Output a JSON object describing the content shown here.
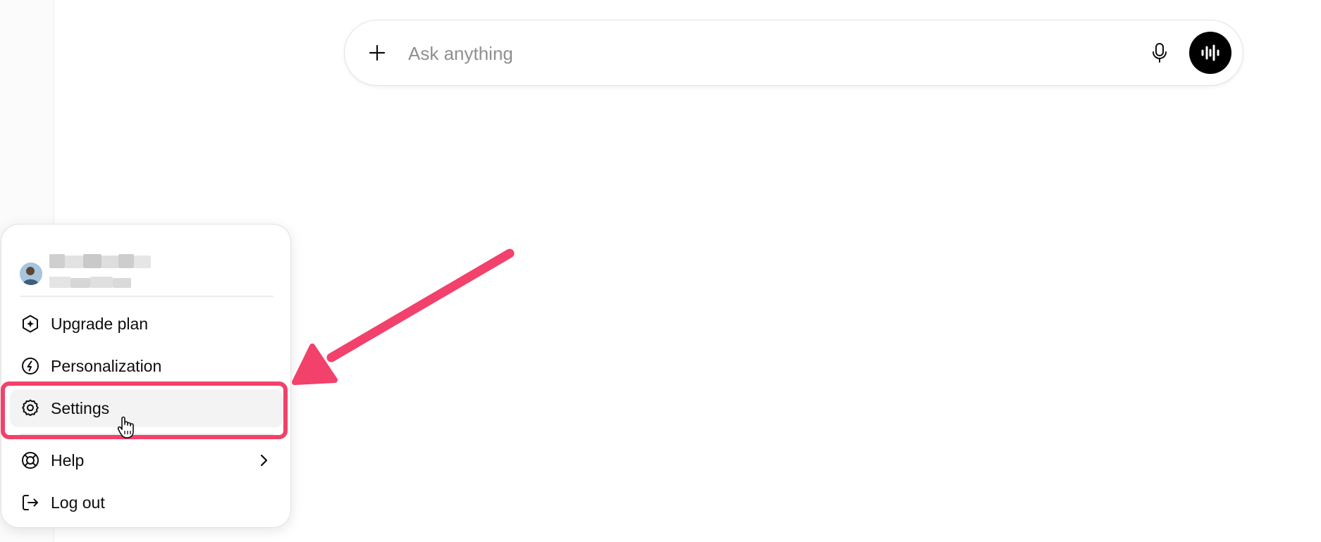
{
  "composer": {
    "placeholder": "Ask anything",
    "plus_icon": "plus-icon",
    "mic_icon": "microphone-icon",
    "voice_icon": "voice-waveform-icon"
  },
  "account_menu": {
    "profile": {
      "avatar_icon": "user-avatar",
      "name": "",
      "email": ""
    },
    "items": [
      {
        "label": "Upgrade plan",
        "icon": "upgrade-sparkle-icon"
      },
      {
        "label": "Personalization",
        "icon": "personalization-icon"
      },
      {
        "label": "Settings",
        "icon": "gear-icon",
        "state": "hovered"
      },
      {
        "label": "Help",
        "icon": "lifebuoy-icon",
        "has_submenu": true
      },
      {
        "label": "Log out",
        "icon": "logout-icon"
      }
    ]
  },
  "annotation": {
    "highlight_color": "#f2416b",
    "arrow_color": "#f2416b",
    "target": "Settings"
  },
  "colors": {
    "background": "#ffffff",
    "text": "#0d0d0d",
    "placeholder": "#8f8f8f",
    "voice_button": "#000000"
  }
}
